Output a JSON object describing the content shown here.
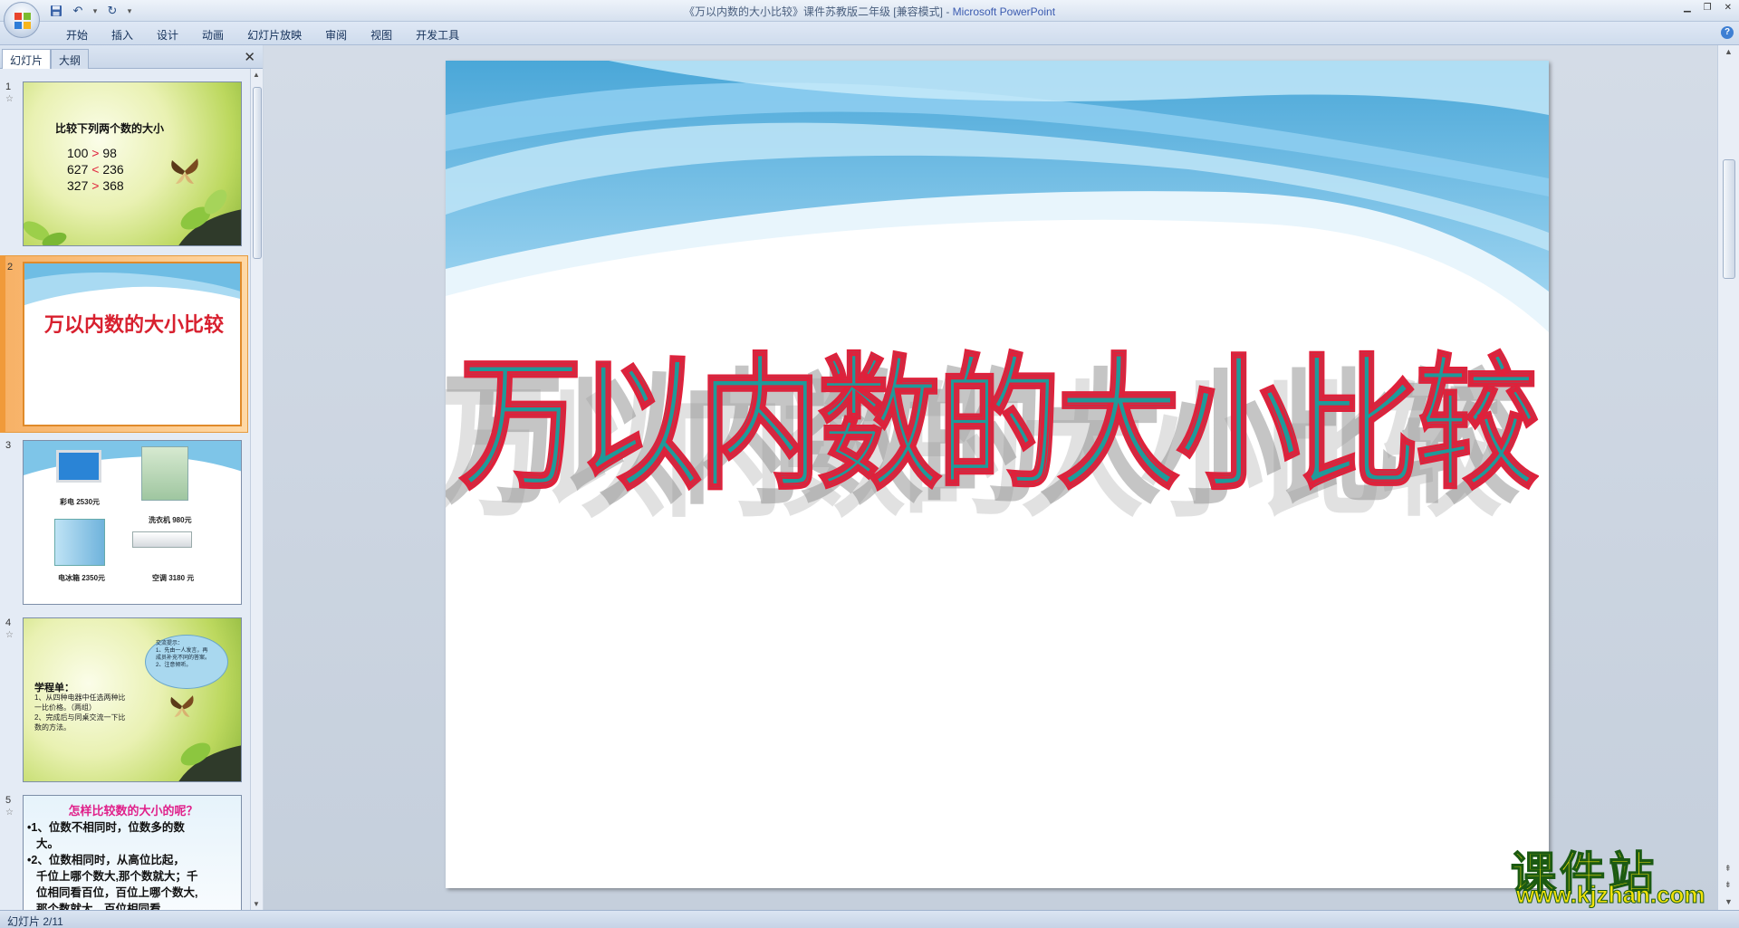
{
  "window": {
    "title": "《万以内数的大小比较》课件苏教版二年级 [兼容模式]",
    "separator": " - ",
    "app_name": "Microsoft PowerPoint",
    "minimize_glyph": "▁",
    "restore_glyph": "❐",
    "close_glyph": "✕"
  },
  "quick_access": {
    "save_icon": "save-icon",
    "undo_glyph": "↶",
    "redo_glyph": "↻",
    "customize_glyph": "▾"
  },
  "ribbon": {
    "tabs": [
      "开始",
      "插入",
      "设计",
      "动画",
      "幻灯片放映",
      "审阅",
      "视图",
      "开发工具"
    ],
    "help_glyph": "?"
  },
  "left_pane": {
    "tab_slides": "幻灯片",
    "tab_outline": "大纲",
    "close_glyph": "✕"
  },
  "slides": [
    {
      "number": "1",
      "star": "☆",
      "heading": "比较下列两个数的大小",
      "rows": [
        {
          "left": "100",
          "op": ">",
          "right": "98"
        },
        {
          "left": "627",
          "op": "<",
          "right": "236"
        },
        {
          "left": "327",
          "op": ">",
          "right": "368"
        }
      ]
    },
    {
      "number": "2",
      "title": "万以内数的大小比较"
    },
    {
      "number": "3",
      "items": [
        {
          "label": "彩电 2530元"
        },
        {
          "label": "洗衣机 980元"
        },
        {
          "label": "电冰箱 2350元"
        },
        {
          "label": "空调 3180 元"
        }
      ]
    },
    {
      "number": "4",
      "star": "☆",
      "bubble_lines": [
        "交流提示：",
        "1、先由一人发言，再",
        "成员补充不同的答案。",
        "2、注意倾听。"
      ],
      "study_title": "学程单：",
      "study_lines": [
        "1、从四种电器中任选两种比",
        "一比价格。（两组）",
        "2、完成后与同桌交流一下比",
        "数的方法。"
      ]
    },
    {
      "number": "5",
      "star": "☆",
      "heading": "怎样比较数的大小的呢？",
      "bullets": [
        "•1、位数不相同时，位数多的数",
        "大。",
        "•2、位数相同时，从高位比起，",
        "千位上哪个数大,那个数就大；千",
        "位相同看百位，百位上哪个数大,",
        "那个数就大，百位相同看"
      ]
    }
  ],
  "main_slide": {
    "title": "万以内数的大小比较"
  },
  "watermark": {
    "name": "课件站",
    "url": "www.kjzhan.com"
  },
  "status": {
    "text": "幻灯片 2/11"
  },
  "colors": {
    "accent_orange": "#f09a3a",
    "title_teal": "#1f9a9a",
    "title_outline_red": "#e0203a",
    "sky_blue": "#5fb4e0"
  }
}
